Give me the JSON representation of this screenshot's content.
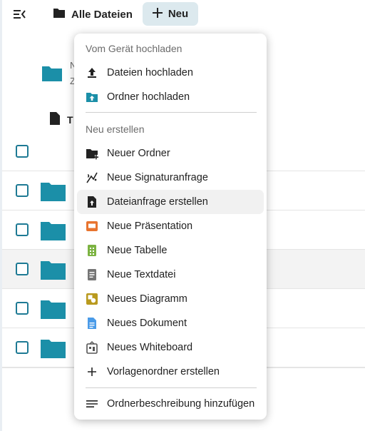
{
  "header": {
    "breadcrumb": "Alle Dateien",
    "new_button": "Neu"
  },
  "background": {
    "row1_trunc_line1": "N",
    "row1_trunc_line2": "Z",
    "name_column_trunc": "T"
  },
  "menu": {
    "upload_section_title": "Vom Gerät hochladen",
    "upload_items": [
      {
        "label": "Dateien hochladen",
        "icon": "upload-icon"
      },
      {
        "label": "Ordner hochladen",
        "icon": "folder-upload-icon"
      }
    ],
    "create_section_title": "Neu erstellen",
    "create_items": [
      {
        "label": "Neuer Ordner",
        "icon": "folder-plus-icon"
      },
      {
        "label": "Neue Signaturanfrage",
        "icon": "signature-icon"
      },
      {
        "label": "Dateianfrage erstellen",
        "icon": "file-upload-icon"
      },
      {
        "label": "Neue Präsentation",
        "icon": "presentation-icon"
      },
      {
        "label": "Neue Tabelle",
        "icon": "spreadsheet-icon"
      },
      {
        "label": "Neue Textdatei",
        "icon": "text-file-icon"
      },
      {
        "label": "Neues Diagramm",
        "icon": "diagram-icon"
      },
      {
        "label": "Neues Dokument",
        "icon": "document-icon"
      },
      {
        "label": "Neues Whiteboard",
        "icon": "whiteboard-icon"
      },
      {
        "label": "Vorlagenordner erstellen",
        "icon": "plus-icon"
      }
    ],
    "footer_item": {
      "label": "Ordnerbeschreibung hinzufügen",
      "icon": "description-icon"
    }
  },
  "colors": {
    "accent": "#1e7a94",
    "folder": "#1b8fa8",
    "new_button_bg": "#dce9ee",
    "presentation": "#e8742f",
    "spreadsheet": "#7cb342",
    "diagram": "#b99a1e",
    "document": "#4a9be8"
  }
}
